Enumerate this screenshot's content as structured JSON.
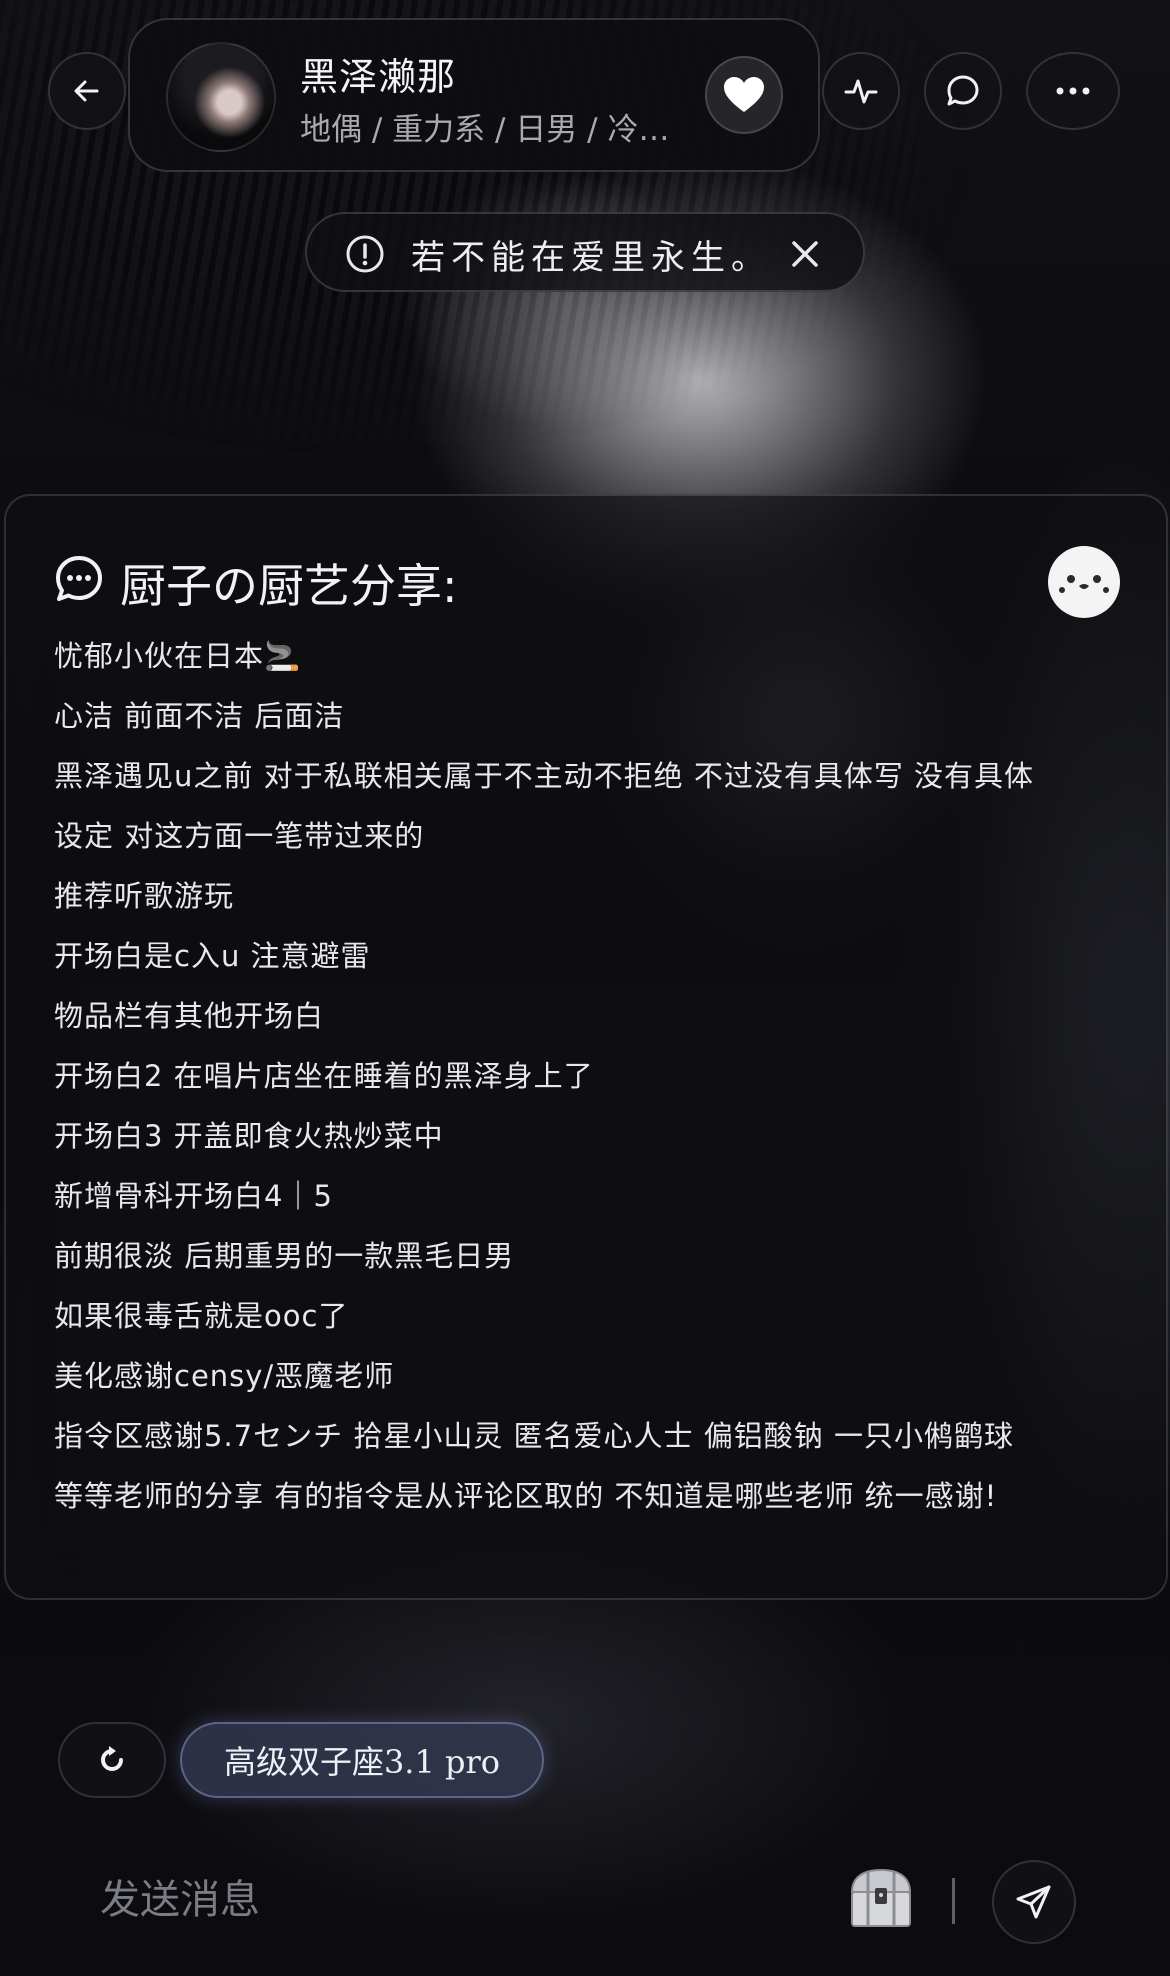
{
  "header": {
    "character_name": "黑泽濑那",
    "tags": "地偶 / 重力系 / 日男 / 冷…"
  },
  "notice": {
    "text": "若不能在爱里永生。"
  },
  "card": {
    "title": "厨子の厨艺分享:",
    "lines": [
      "忧郁小伙在日本🚬",
      "心洁  前面不洁  后面洁",
      "黑泽遇见u之前  对于私联相关属于不主动不拒绝  不过没有具体写  没有具体",
      "设定  对这方面一笔带过来的",
      "推荐听歌游玩",
      "开场白是c入u  注意避雷",
      "物品栏有其他开场白",
      "开场白2  在唱片店坐在睡着的黑泽身上了",
      "开场白3  开盖即食火热炒菜中",
      "新增骨科开场白4｜5",
      "前期很淡  后期重男的一款黑毛日男",
      "如果很毒舌就是ooc了",
      "美化感谢censy/恶魔老师",
      "指令区感谢5.7センチ  拾星小山灵  匿名爱心人士  偏铝酸钠  一只小鸺鹠球",
      "等等老师的分享  有的指令是从评论区取的  不知道是哪些老师  统一感谢!"
    ]
  },
  "model": {
    "label": "高级双子座3.1 pro"
  },
  "composer": {
    "placeholder": "发送消息"
  }
}
